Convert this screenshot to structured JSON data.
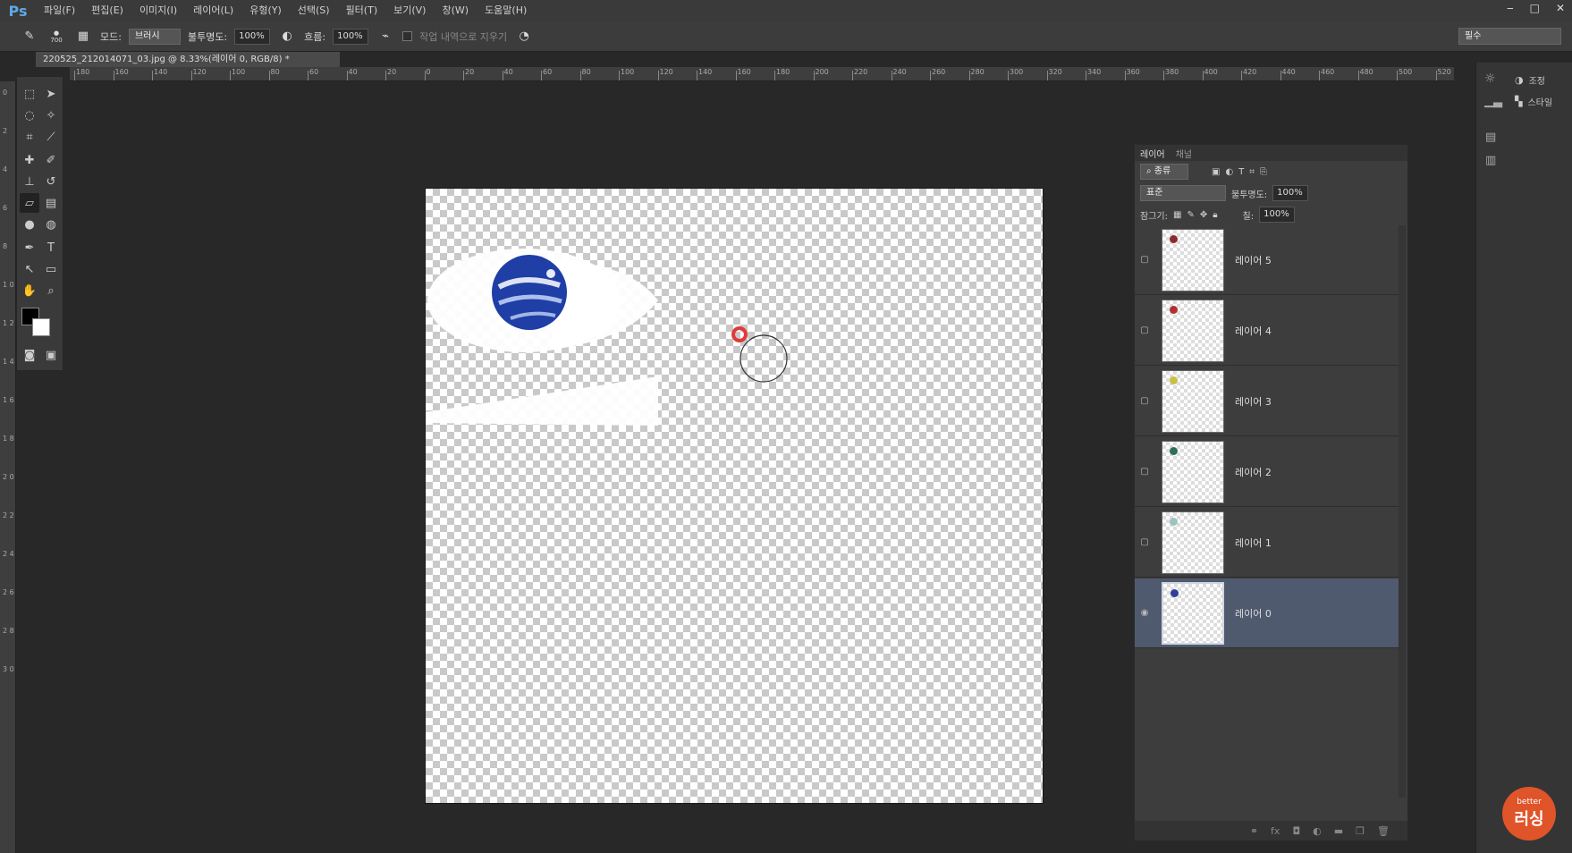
{
  "app": {
    "logo": "Ps"
  },
  "menu": [
    "파일(F)",
    "편집(E)",
    "이미지(I)",
    "레이어(L)",
    "유형(Y)",
    "선택(S)",
    "필터(T)",
    "보기(V)",
    "창(W)",
    "도움말(H)"
  ],
  "window_controls": {
    "minimize": "‒",
    "maximize": "□",
    "close": "✕"
  },
  "options": {
    "brush_size": "700",
    "mode_label": "모드:",
    "mode_value": "브러시",
    "opacity_label": "불투명도:",
    "opacity_value": "100%",
    "flow_label": "흐름:",
    "flow_value": "100%",
    "erase_history_label": "작업 내역으로 지우기"
  },
  "workspace": "필수",
  "document_tab": "220525_212014071_03.jpg @ 8.33%(레이어 0, RGB/8) *",
  "ruler_h_labels": [
    "180",
    "160",
    "140",
    "120",
    "100",
    "80",
    "60",
    "40",
    "20",
    "0",
    "20",
    "40",
    "60",
    "80",
    "100",
    "120",
    "140",
    "160",
    "180",
    "200",
    "220",
    "240",
    "260",
    "280",
    "300",
    "320",
    "340",
    "360",
    "380",
    "400",
    "420",
    "440",
    "460",
    "480",
    "500",
    "520"
  ],
  "ruler_v_labels": [
    "0",
    "2",
    "4",
    "6",
    "8",
    "1 0",
    "1 2",
    "1 4",
    "1 6",
    "1 8",
    "2 0",
    "2 2",
    "2 4",
    "2 6",
    "2 8",
    "3 0"
  ],
  "right_panel": {
    "adjust_label": "조정",
    "style_label": "스타일"
  },
  "layers_panel": {
    "tabs": [
      "레이어",
      "채널"
    ],
    "filter_kind": "종류",
    "blend_mode": "표준",
    "opacity_label": "불투명도:",
    "opacity_value": "100%",
    "lock_label": "잠그기:",
    "fill_label": "칠:",
    "fill_value": "100%",
    "layers": [
      {
        "name": "레이어 5",
        "dot": "#8b2b2b",
        "visible": false,
        "selected": false
      },
      {
        "name": "레이어 4",
        "dot": "#b03030",
        "visible": false,
        "selected": false
      },
      {
        "name": "레이어 3",
        "dot": "#c8c040",
        "visible": false,
        "selected": false
      },
      {
        "name": "레이어 2",
        "dot": "#2f6f5a",
        "visible": false,
        "selected": false
      },
      {
        "name": "레이어 1",
        "dot": "#9cc4c0",
        "visible": false,
        "selected": false
      },
      {
        "name": "레이어 0",
        "dot": "#2f3f9a",
        "visible": true,
        "selected": true
      }
    ],
    "footer_icons": [
      "link-icon",
      "fx-icon",
      "mask-icon",
      "adjustment-icon",
      "folder-icon",
      "new-layer-icon",
      "trash-icon"
    ]
  },
  "watermark": {
    "top": "better",
    "main": "러싱"
  }
}
